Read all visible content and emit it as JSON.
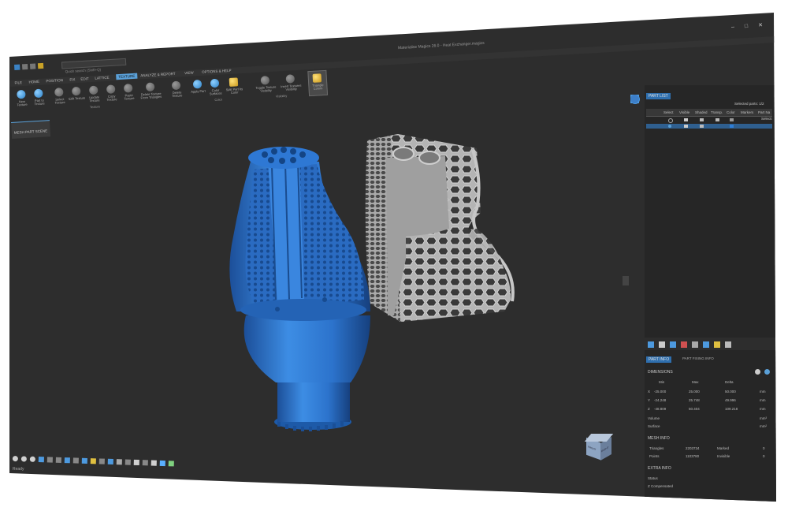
{
  "window": {
    "title": "Materialise Magics 26.0 - Heat Exchanger.magics",
    "controls": [
      "–",
      "□",
      "✕"
    ]
  },
  "quick_toolbar": {
    "search_placeholder": "Quick search (Shift+Q)"
  },
  "ribbon": {
    "tabs": [
      "FILE",
      "HOME",
      "POSITION",
      "FIX",
      "EDIT",
      "LATTICE",
      "TEXTURE",
      "ANALYZE & REPORT",
      "VIEW",
      "OPTIONS & HELP"
    ],
    "active_tab": "TEXTURE",
    "buttons": [
      {
        "label": "New Texture",
        "icon": "new-texture-icon"
      },
      {
        "label": "Part to Texture",
        "icon": "part-to-texture-icon"
      },
      {
        "label": "Select Texture",
        "icon": "select-texture-icon"
      },
      {
        "label": "Edit Texture",
        "icon": "edit-texture-icon"
      },
      {
        "label": "Update Texture",
        "icon": "update-texture-icon"
      },
      {
        "label": "Copy Texture",
        "icon": "copy-texture-icon"
      },
      {
        "label": "Paste Texture",
        "icon": "paste-texture-icon"
      },
      {
        "label": "Delete Texture From Triangles",
        "icon": "delete-texture-triangles-icon"
      },
      {
        "label": "Delete Texture",
        "icon": "delete-texture-icon"
      },
      {
        "label": "Apply Part",
        "icon": "apply-part-icon"
      },
      {
        "label": "Color Surfaces",
        "icon": "color-surfaces-icon"
      },
      {
        "label": "Split Part by Color",
        "icon": "split-by-color-icon"
      },
      {
        "label": "Toggle Texture Visibility",
        "icon": "toggle-visibility-icon"
      },
      {
        "label": "Invert Textures Visibility",
        "icon": "invert-visibility-icon"
      },
      {
        "label": "Triangle Colors",
        "icon": "triangle-colors-icon"
      }
    ],
    "groups": [
      "Texture",
      "Color",
      "Visibility"
    ]
  },
  "scene_tab": "MESH PART SCENE",
  "right_panel": {
    "part_list_tab": "PART LIST",
    "selected_parts": "Selected parts: 1/2",
    "columns": [
      "Select",
      "Visible",
      "Shaded",
      "Transp.",
      "Color",
      "Markers",
      "Part Na"
    ],
    "row_extra": "Selecti",
    "info_tabs": [
      "PART INFO",
      "PART FIXING INFO"
    ],
    "dimensions_title": "DIMENSIONS",
    "dim_headers": [
      "Min",
      "Max",
      "Delta"
    ],
    "dims": [
      {
        "axis": "X",
        "min": "-25.000",
        "max": "25.000",
        "delta": "50.000",
        "unit": "mm"
      },
      {
        "axis": "Y",
        "min": "-24.248",
        "max": "25.748",
        "delta": "49.996",
        "unit": "mm"
      },
      {
        "axis": "Z",
        "min": "-48.809",
        "max": "50.404",
        "delta": "109.218",
        "unit": "mm"
      }
    ],
    "volume_label": "Volume",
    "volume_unit": "mm³",
    "surface_label": "Surface",
    "surface_unit": "mm²",
    "mesh_title": "MESH INFO",
    "mesh": {
      "triangles_label": "Triangles",
      "triangles": "2203734",
      "points_label": "Points",
      "points": "1103780",
      "marked_label": "Marked",
      "invisible_label": "Invisible",
      "marked_value": "0",
      "invisible_value": "0"
    },
    "extra_title": "EXTRA INFO",
    "status_label": "Status",
    "z_comp_label": "Z Compensated"
  },
  "status_bar": {
    "text": "Ready"
  },
  "view_cube": {
    "front": "FRONT",
    "right": "RIGHT"
  },
  "colors": {
    "part_blue": "#2f7ed6",
    "part_gray": "#a8a8a8",
    "active_tab": "#5aa0d8",
    "background": "#2d2d2d"
  }
}
